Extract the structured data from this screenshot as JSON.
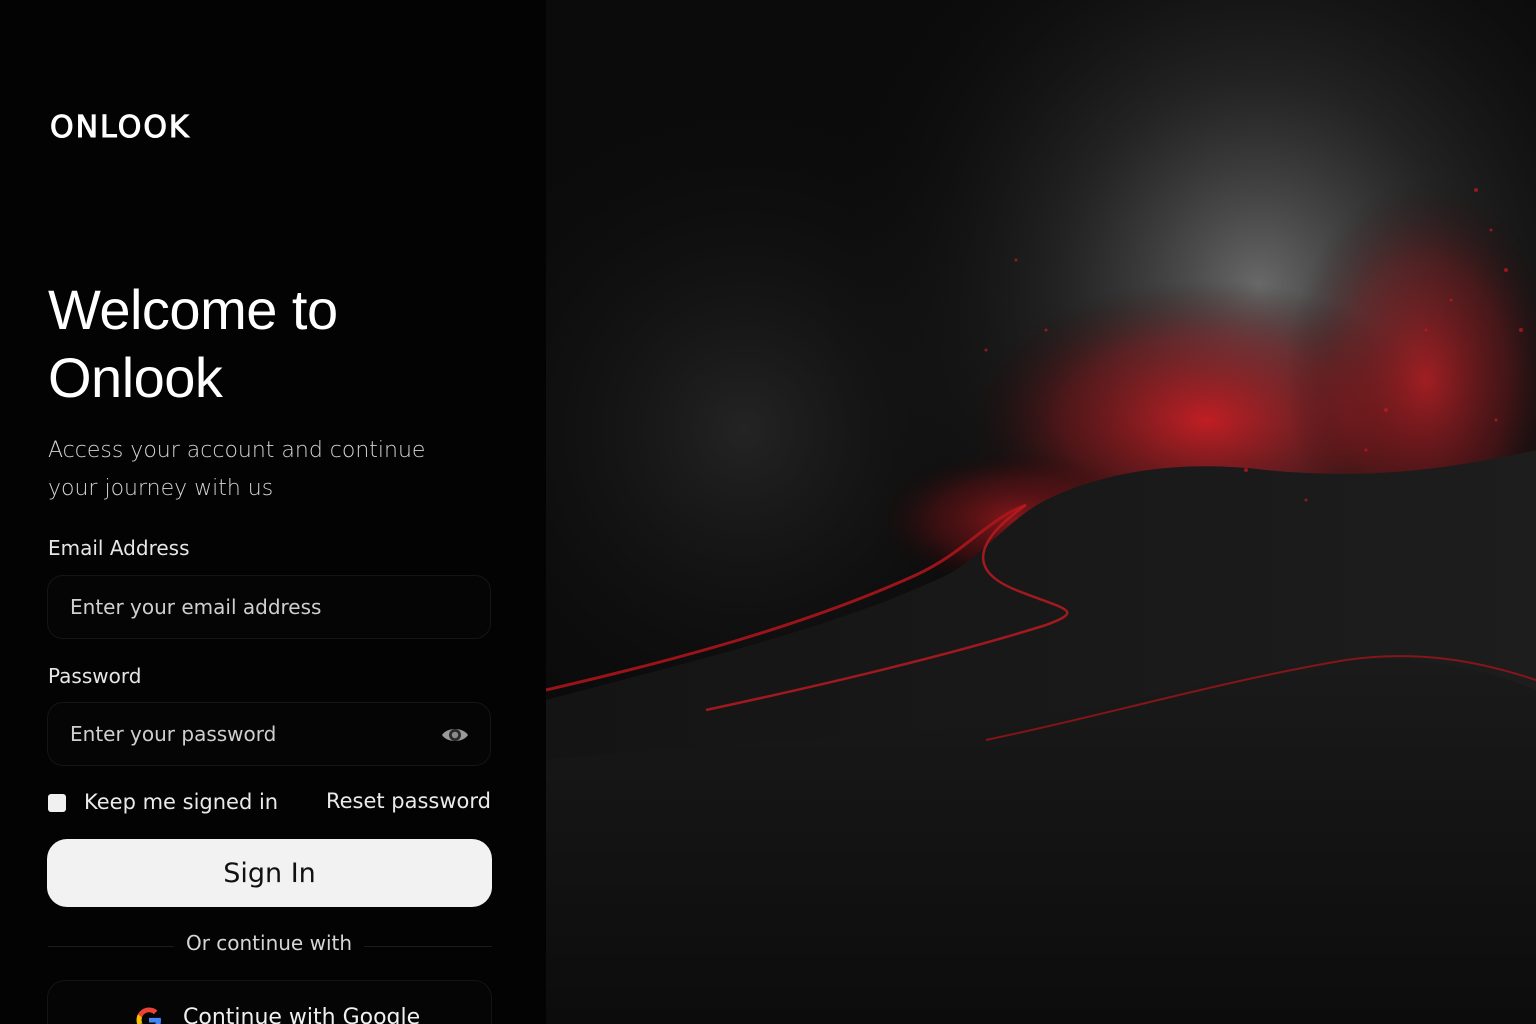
{
  "brand": {
    "logo": "ONLOOK"
  },
  "hero": {
    "title": "Welcome to Onlook",
    "subtitle": "Access your account and continue your journey with us"
  },
  "form": {
    "email_label": "Email Address",
    "email_placeholder": "Enter your email address",
    "email_value": "",
    "password_label": "Password",
    "password_placeholder": "Enter your password",
    "password_value": "",
    "keep_signed_in_label": "Keep me signed in",
    "keep_signed_in_checked": false,
    "reset_password_label": "Reset password",
    "sign_in_label": "Sign In",
    "divider_text": "Or continue with",
    "google_label": "Continue with Google"
  },
  "icons": {
    "password_toggle": "eye-icon",
    "google": "google-icon"
  },
  "colors": {
    "background": "#000000",
    "primary_button": "#f2f2f2",
    "accent_red": "#c0181d"
  }
}
